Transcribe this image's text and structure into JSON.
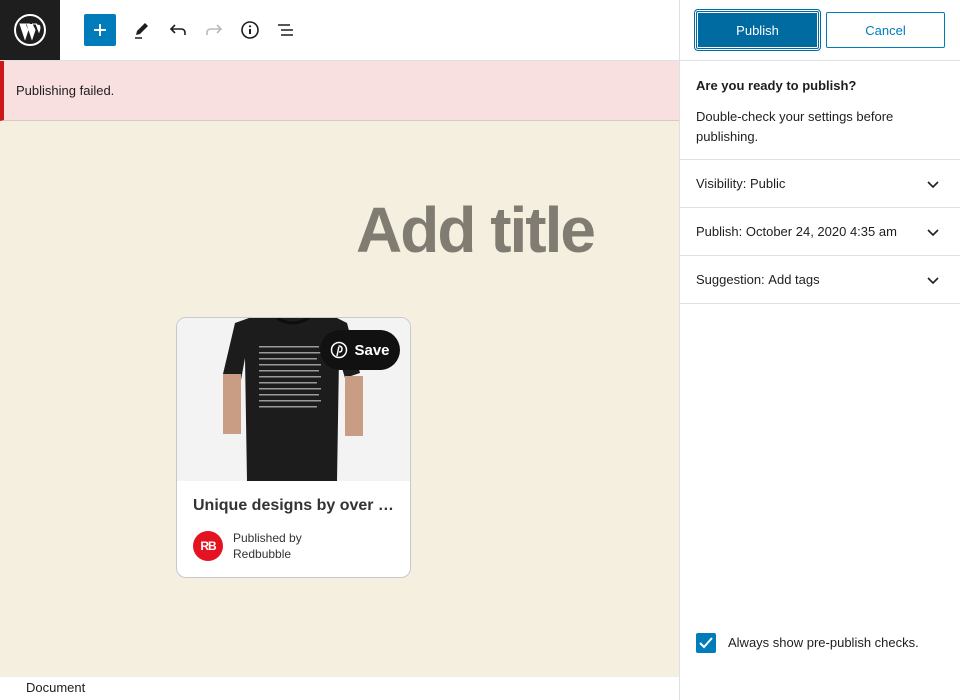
{
  "toolbar": {
    "icons": [
      "wordpress-logo",
      "add-block",
      "tools-pencil",
      "undo",
      "redo",
      "info",
      "list-view"
    ]
  },
  "notice": {
    "text": "Publishing failed."
  },
  "editor": {
    "title_placeholder": "Add title",
    "embed_card": {
      "save_label": "Save",
      "title": "Unique designs by over …",
      "published_by_line1": "Published by",
      "published_by_line2": "Redbubble",
      "publisher_logo_text": "RB"
    }
  },
  "footer": {
    "breadcrumb": "Document"
  },
  "sidebar": {
    "publish_label": "Publish",
    "cancel_label": "Cancel",
    "heading": "Are you ready to publish?",
    "description": "Double-check your settings before publishing.",
    "rows": [
      {
        "label": "Visibility:",
        "value": "Public"
      },
      {
        "label": "Publish:",
        "value": "October 24, 2020 4:35 am"
      },
      {
        "label": "Suggestion:",
        "value": "Add tags"
      }
    ],
    "checkbox_label": "Always show pre-publish checks.",
    "checkbox_checked": true
  },
  "colors": {
    "accent": "#007cba",
    "publish_bg": "#006ba1",
    "error": "#cc1818",
    "notice_bg": "#f8dfe0",
    "canvas_bg": "#f5efe0",
    "title_placeholder": "#807c72",
    "redbubble": "#e41321"
  }
}
